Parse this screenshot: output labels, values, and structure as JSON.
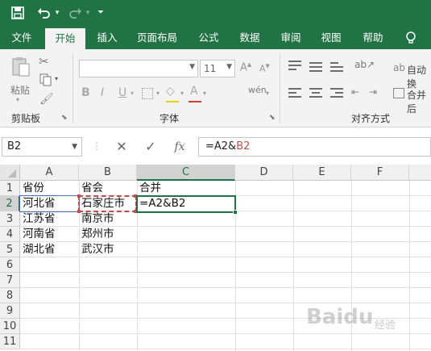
{
  "quick_access": {
    "save_icon": "save-icon",
    "undo_icon": "undo-icon",
    "redo_icon": "redo-icon",
    "customize_icon": "customize-qat-icon"
  },
  "tabs": [
    {
      "label": "文件"
    },
    {
      "label": "开始"
    },
    {
      "label": "插入"
    },
    {
      "label": "页面布局"
    },
    {
      "label": "公式"
    },
    {
      "label": "数据"
    },
    {
      "label": "审阅"
    },
    {
      "label": "视图"
    },
    {
      "label": "帮助"
    }
  ],
  "active_tab": "开始",
  "ribbon": {
    "clipboard": {
      "paste_label": "粘贴",
      "group_label": "剪贴板"
    },
    "font": {
      "font_name": "",
      "font_size": "11",
      "group_label": "字体"
    },
    "alignment": {
      "wrap_text": "自动换",
      "merge_center": "合并后",
      "group_label": "对齐方式"
    }
  },
  "formula_bar": {
    "name_box": "B2",
    "cancel_icon": "cancel-icon",
    "enter_icon": "enter-icon",
    "fx_label": "fx",
    "formula_part1": "=A2&",
    "formula_part2": "B2"
  },
  "sheet": {
    "columns": [
      "A",
      "B",
      "C",
      "D",
      "E",
      "F"
    ],
    "rows": [
      "1",
      "2",
      "3",
      "4",
      "5",
      "6",
      "7",
      "8",
      "9",
      "10",
      "11"
    ],
    "cells": {
      "A1": "省份",
      "B1": "省会",
      "C1": "合并",
      "A2": "河北省",
      "B2": "石家庄市",
      "C2": "=A2&B2",
      "A3": "江苏省",
      "B3": "南京市",
      "A4": "河南省",
      "B4": "郑州市",
      "A5": "湖北省",
      "B5": "武汉市"
    }
  },
  "colors": {
    "excel_green": "#217346",
    "ref_blue": "#4472c4",
    "ref_red": "#c0504d"
  },
  "watermark": {
    "text": "Baidu",
    "suffix": "经验"
  }
}
